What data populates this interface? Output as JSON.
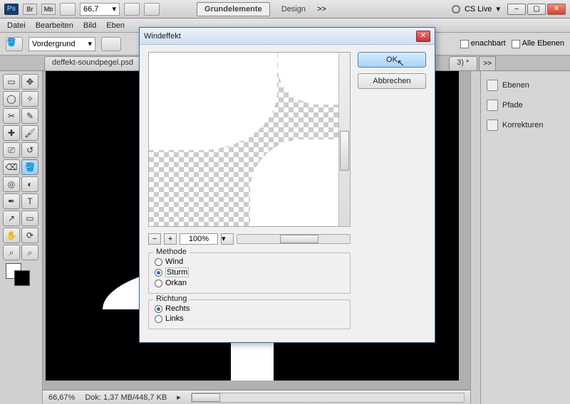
{
  "appbar": {
    "ps": "Ps",
    "btn_br": "Br",
    "btn_mb": "Mb",
    "zoom_pct": "66,7",
    "ws_primary": "Grundelemente",
    "ws_secondary": "Design",
    "more": ">>",
    "cslive": "CS Live"
  },
  "menu": {
    "items": [
      "Datei",
      "Bearbeiten",
      "Bild",
      "Eben"
    ]
  },
  "optbar": {
    "mode_label": "Vordergrund",
    "adjacent": "enachbart",
    "all_layers": "Alle Ebenen"
  },
  "doctabs": {
    "tab1": "deffekt-soundpegel.psd",
    "tab2": "3) *",
    "more": ">>"
  },
  "right_panel": {
    "items": [
      "Ebenen",
      "Pfade",
      "Korrekturen"
    ]
  },
  "statusbar": {
    "zoom": "66,67%",
    "docinfo": "Dok: 1,37 MB/448,7 KB"
  },
  "dialog": {
    "title": "Windeffekt",
    "ok": "OK",
    "cancel": "Abbrechen",
    "zoom": "100%",
    "method_label": "Methode",
    "methods": {
      "wind": "Wind",
      "sturm": "Sturm",
      "orkan": "Orkan"
    },
    "direction_label": "Richtung",
    "directions": {
      "rechts": "Rechts",
      "links": "Links"
    },
    "selected_method": "sturm",
    "selected_direction": "rechts"
  },
  "tools": [
    "▭",
    "↖",
    "◯",
    "✦",
    "✂",
    "✎",
    "✚",
    "◐",
    "▭",
    "⌀",
    "◍",
    "⎚",
    "✏",
    "⌫",
    "⬚",
    "◧",
    "◌",
    "⬤",
    "✎",
    "T",
    "↗",
    "▭",
    "✋",
    "⌕",
    "⟳",
    "⌕"
  ]
}
